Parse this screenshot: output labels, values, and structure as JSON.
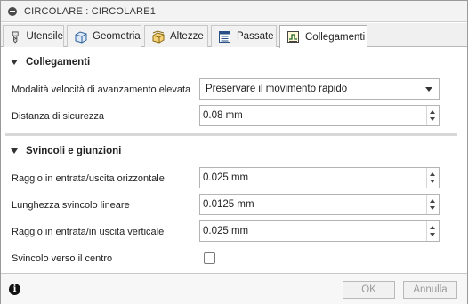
{
  "window": {
    "title": "CIRCOLARE : CIRCOLARE1"
  },
  "tabs": [
    {
      "label": "Utensile",
      "icon": "tool-bit-icon",
      "active": false
    },
    {
      "label": "Geometria",
      "icon": "geometry-cube-icon",
      "active": false
    },
    {
      "label": "Altezze",
      "icon": "heights-box-icon",
      "active": false
    },
    {
      "label": "Passate",
      "icon": "passes-list-icon",
      "active": false
    },
    {
      "label": "Collegamenti",
      "icon": "linking-icon",
      "active": true
    }
  ],
  "collegamenti": {
    "header": "Collegamenti",
    "rapid_label": "Modalità velocità di avanzamento elevata",
    "rapid_value": "Preservare il movimento rapido",
    "safe_distance_label": "Distanza di sicurezza",
    "safe_distance_value": "0.08 mm"
  },
  "svincoli": {
    "header": "Svincoli e giunzioni",
    "horizontal_radius_label": "Raggio in entrata/uscita orizzontale",
    "horizontal_radius_value": "0.025 mm",
    "linear_retract_label": "Lunghezza svincolo lineare",
    "linear_retract_value": "0.0125 mm",
    "vertical_radius_label": "Raggio in entrata/in uscita verticale",
    "vertical_radius_value": "0.025 mm",
    "retract_center_label": "Svincolo verso il centro",
    "retract_center_checked": false
  },
  "footer": {
    "ok_label": "OK",
    "cancel_label": "Annulla"
  }
}
